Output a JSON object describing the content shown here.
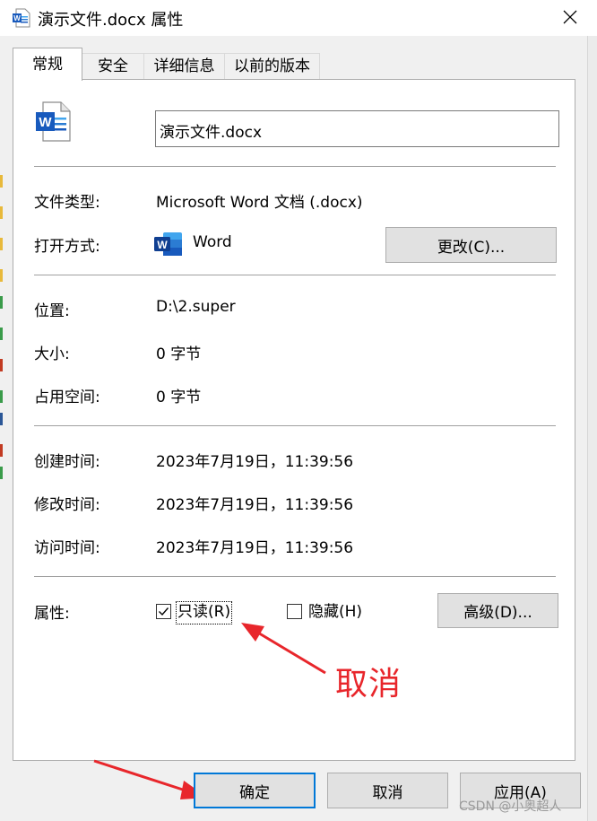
{
  "window": {
    "title": "演示文件.docx 属性",
    "close_glyph": "✕"
  },
  "tabs": [
    {
      "label": "常规",
      "active": true
    },
    {
      "label": "安全",
      "active": false
    },
    {
      "label": "详细信息",
      "active": false
    },
    {
      "label": "以前的版本",
      "active": false
    }
  ],
  "general": {
    "file_name": "演示文件.docx",
    "file_type_label": "文件类型:",
    "file_type_value": "Microsoft Word 文档 (.docx)",
    "opens_with_label": "打开方式:",
    "opens_with_value": "Word",
    "change_button": "更改(C)...",
    "location_label": "位置:",
    "location_value": "D:\\2.super",
    "size_label": "大小:",
    "size_value": "0 字节",
    "size_on_disk_label": "占用空间:",
    "size_on_disk_value": "0 字节",
    "created_label": "创建时间:",
    "created_value": "2023年7月19日，11:39:56",
    "modified_label": "修改时间:",
    "modified_value": "2023年7月19日，11:39:56",
    "accessed_label": "访问时间:",
    "accessed_value": "2023年7月19日，11:39:56",
    "attributes_label": "属性:",
    "readonly_label": "只读(R)",
    "readonly_checked": true,
    "hidden_label": "隐藏(H)",
    "hidden_checked": false,
    "advanced_button": "高级(D)..."
  },
  "footer": {
    "ok": "确定",
    "cancel": "取消",
    "apply": "应用(A)"
  },
  "annotation": {
    "text": "取消",
    "color": "#e8262b"
  },
  "watermark": "CSDN @小奥超人",
  "colors": {
    "word_blue": "#185abd",
    "focus_border": "#0078d7"
  },
  "icons": [
    "word-doc-icon",
    "word-app-icon",
    "close-icon",
    "checkmark-icon",
    "red-arrow"
  ]
}
